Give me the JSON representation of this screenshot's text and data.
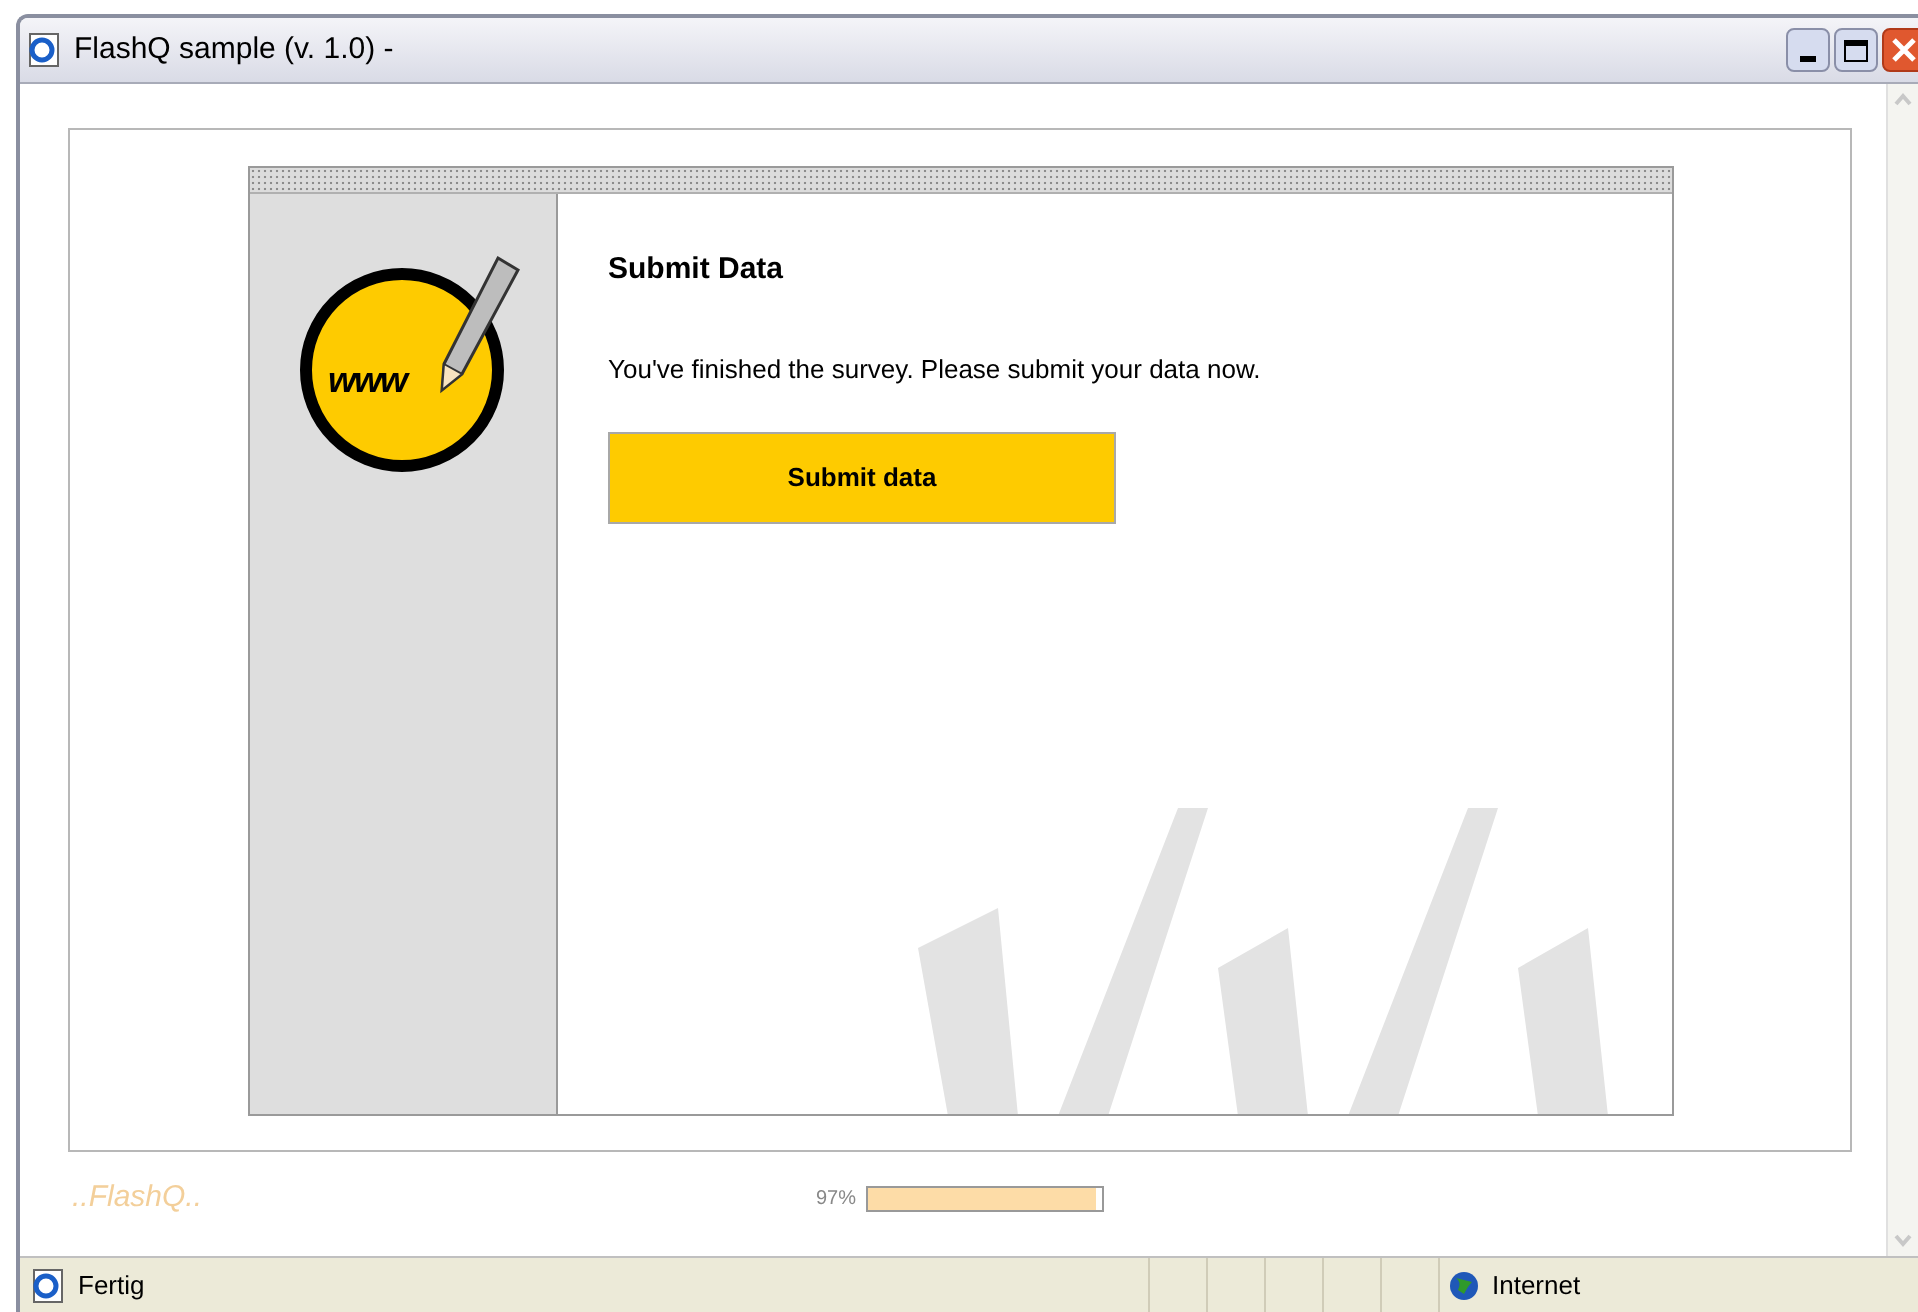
{
  "window": {
    "title": "FlashQ sample (v. 1.0) -"
  },
  "logo": {
    "text": "www"
  },
  "page": {
    "heading": "Submit Data",
    "message": "You've finished the survey. Please submit your data now.",
    "button": "Submit data"
  },
  "footer": {
    "brand": "..FlashQ..",
    "progress": {
      "reading": "97%",
      "level": 0.97
    }
  },
  "status_bar": {
    "status": "Fertig",
    "zone": "Internet"
  }
}
